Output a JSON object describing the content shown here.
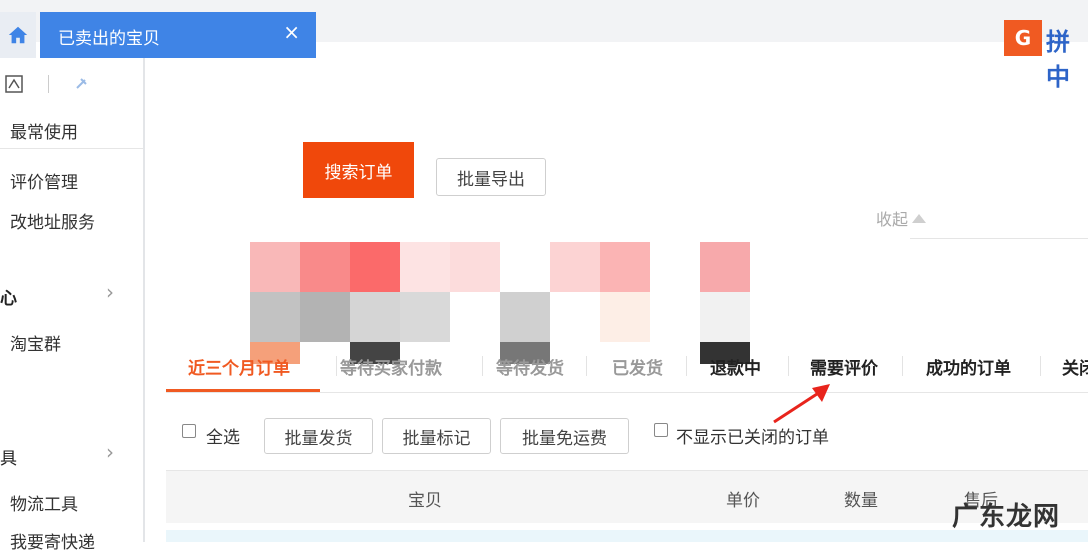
{
  "tabs_bar": {
    "active_tab_label": "已卖出的宝贝",
    "close_glyph": "×",
    "home_icon": "home-icon"
  },
  "logo": {
    "mark": "G",
    "text": "拼 中"
  },
  "sidebar": {
    "favorites_label": "最常使用",
    "items": [
      {
        "label": "评价管理"
      },
      {
        "label": "改地址服务"
      }
    ],
    "section1_label": "心",
    "section1_items": [
      {
        "label": "淘宝群"
      }
    ],
    "section2_label": "具",
    "section2_items": [
      {
        "label": "物流工具"
      },
      {
        "label": "我要寄快递"
      }
    ],
    "chevron": "›"
  },
  "search": {
    "search_button": "搜索订单",
    "export_button": "批量导出",
    "collapse_label": "收起"
  },
  "order_tabs": [
    {
      "label": "近三个月订单",
      "state": "active"
    },
    {
      "label": "等待买家付款",
      "state": "dim"
    },
    {
      "label": "等待发货",
      "state": "dim"
    },
    {
      "label": "已发货",
      "state": "dim"
    },
    {
      "label": "退款中",
      "state": "normal"
    },
    {
      "label": "需要评价",
      "state": "normal"
    },
    {
      "label": "成功的订单",
      "state": "normal"
    },
    {
      "label": "关闭",
      "state": "normal"
    }
  ],
  "actions": {
    "select_all": "全选",
    "batch_ship": "批量发货",
    "batch_mark": "批量标记",
    "batch_free_shipping": "批量免运费",
    "hide_closed": "不显示已关闭的订单"
  },
  "table": {
    "columns": [
      "宝贝",
      "单价",
      "数量",
      "售后"
    ]
  },
  "watermark": "广东龙网",
  "colors": {
    "accent": "#f05a22",
    "tab_blue": "#3f84e6",
    "annotation_arrow": "#e8241c"
  }
}
